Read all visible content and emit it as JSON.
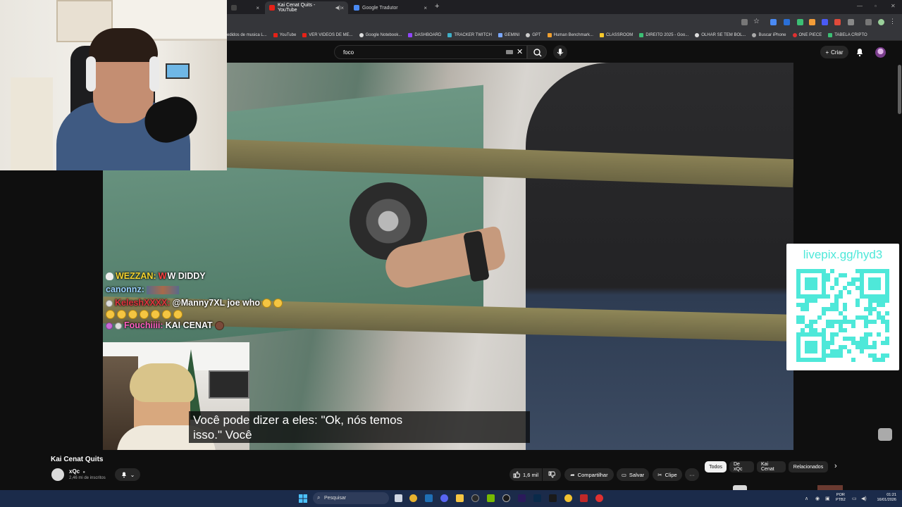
{
  "browser": {
    "tabs": [
      {
        "title": "",
        "close": "×"
      },
      {
        "title": "Kai Cenat Quits - YouTube",
        "close": "×"
      },
      {
        "title": "Google Tradutor",
        "close": "×"
      }
    ],
    "new_tab": "+",
    "bookmarks": [
      "edidos de musica L...",
      "YouTube",
      "VER VIDEOS DE ME...",
      "Google Notebook...",
      "DASHBOARD",
      "TRACKER TWITCH",
      "GEMINI",
      "GPT",
      "Human Benchmark...",
      "CLASSROOM",
      "DIREITO 2025 - Goo...",
      "OLHAR SE TEM BOL...",
      "Buscar iPhone",
      "ONE PIECE",
      "TABELA CRIPTO"
    ]
  },
  "youtube": {
    "search_value": "foco",
    "clear": "✕",
    "create_label": "Criar",
    "create_plus": "+"
  },
  "stream": {
    "chat": [
      {
        "user": "WEZZAN:",
        "user_color": "#f4d430",
        "message": "W DIDDY",
        "w": "W"
      },
      {
        "user": "canonnz:",
        "user_color": "#9ad0ff",
        "message": ""
      },
      {
        "user": "KeleshXXXX:",
        "user_color": "#e0343f",
        "message": "@Manny7XL joe who"
      },
      {
        "user": "",
        "user_color": "#ffffff",
        "message": ""
      },
      {
        "user": "Fouchiiii:",
        "user_color": "#ff5fbf",
        "message": "KAI CENAT"
      }
    ],
    "subtitle_line1": "Você pode dizer a eles: \"Ok, nós temos",
    "subtitle_line2": "isso.\"  Você",
    "qr_label": "livepix.gg/hyd3"
  },
  "video": {
    "title": "Kai Cenat Quits",
    "channel": "xQc",
    "verified": "●",
    "subscribers": "2,46 mi de inscritos",
    "likes": "1,6 mil",
    "share": "Compartilhar",
    "save": "Salvar",
    "clip": "Clipe",
    "more": "···",
    "chevron": "⌄"
  },
  "chips": [
    "Todos",
    "De xQc",
    "Kai Cenat",
    "Relacionados"
  ],
  "chips_next": "›",
  "taskbar": {
    "search_label": "Pesquisar",
    "lang_line1": "POR",
    "lang_line2": "PTB2",
    "time": "01:21",
    "date": "16/01/2026"
  },
  "colors": {
    "yt_bg": "#0f0f0f",
    "chrome_bg": "#35363a",
    "taskbar_bg": "#1b2b4a",
    "qr_teal": "#4ee8d9"
  }
}
